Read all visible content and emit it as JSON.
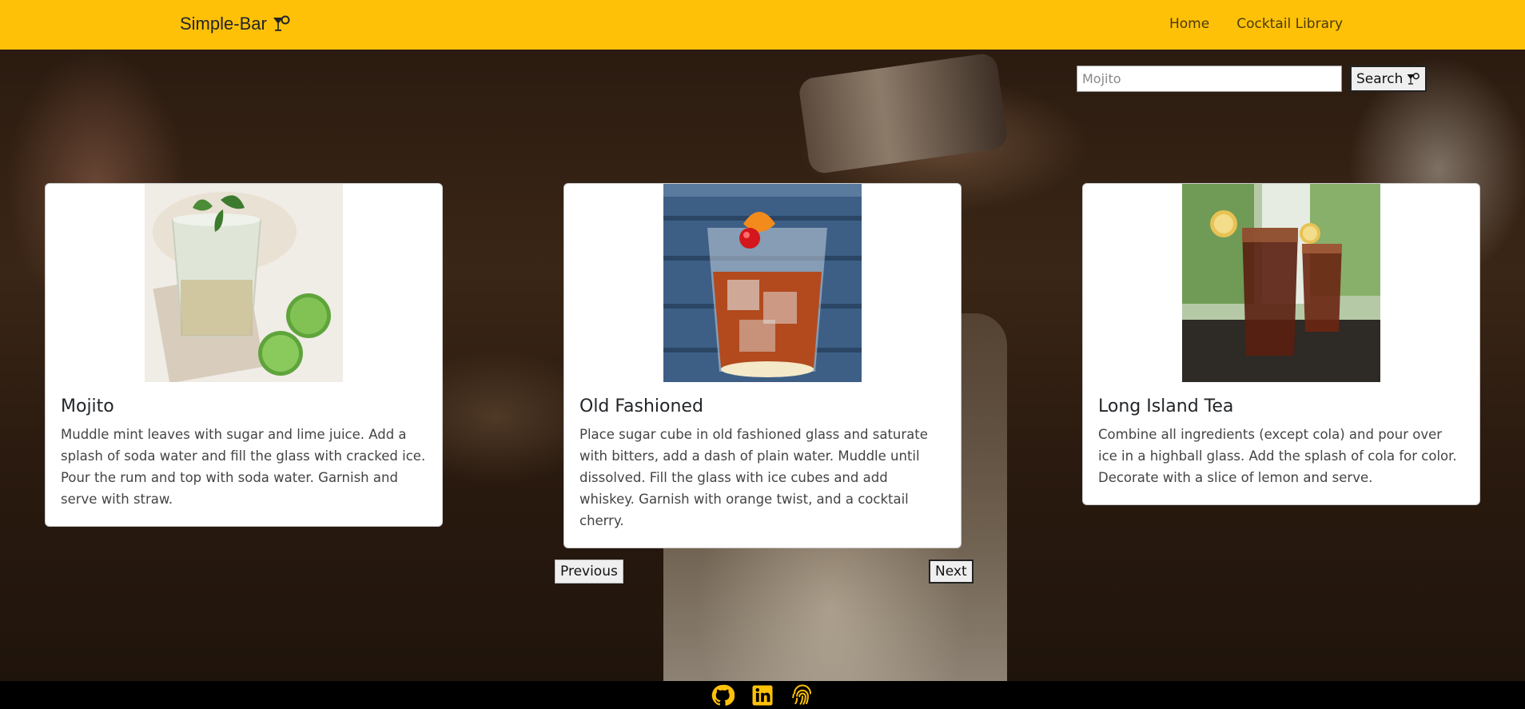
{
  "brand": {
    "name": "Simple-Bar",
    "icon": "cocktail-icon"
  },
  "nav": {
    "items": [
      {
        "label": "Home"
      },
      {
        "label": "Cocktail Library"
      }
    ]
  },
  "search": {
    "placeholder": "Mojito",
    "value": "",
    "button_label": "Search",
    "button_icon": "cocktail-icon"
  },
  "cards": [
    {
      "title": "Mojito",
      "image_icon": "mojito-photo",
      "text": "Muddle mint leaves with sugar and lime juice. Add a splash of soda water and fill the glass with cracked ice. Pour the rum and top with soda water. Garnish and serve with straw."
    },
    {
      "title": "Old Fashioned",
      "image_icon": "old-fashioned-photo",
      "text": "Place sugar cube in old fashioned glass and saturate with bitters, add a dash of plain water. Muddle until dissolved. Fill the glass with ice cubes and add whiskey. Garnish with orange twist, and a cocktail cherry."
    },
    {
      "title": "Long Island Tea",
      "image_icon": "long-island-tea-photo",
      "text": "Combine all ingredients (except cola) and pour over ice in a highball glass. Add the splash of cola for color. Decorate with a slice of lemon and serve."
    }
  ],
  "pagination": {
    "previous_label": "Previous",
    "next_label": "Next"
  },
  "footer": {
    "icons": [
      "github-icon",
      "linkedin-icon",
      "fingerprint-icon"
    ]
  },
  "colors": {
    "navbar": "#ffc107",
    "footer": "#000000",
    "footer_icons": "#ffc107",
    "card_bg": "#ffffff"
  }
}
